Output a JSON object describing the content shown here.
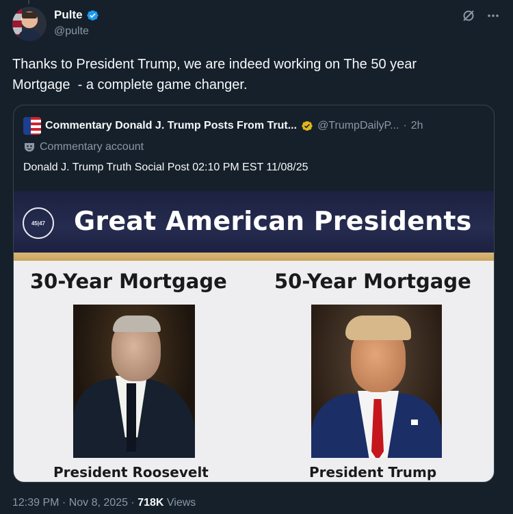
{
  "author": {
    "name": "Pulte",
    "handle": "@pulte"
  },
  "post": {
    "text": "Thanks to President Trump, we are indeed working on The 50 year\nMortgage  - a complete game changer."
  },
  "quote": {
    "name": "Commentary Donald J. Trump Posts From Trut...",
    "handle": "@TrumpDailyP...",
    "separator": "·",
    "time": "2h",
    "label": "Commentary account",
    "text": "Donald J. Trump Truth Social Post 02:10 PM EST 11/08/25"
  },
  "image": {
    "seal_text": "45|47",
    "title": "Great American Presidents",
    "left_title": "30-Year Mortgage",
    "right_title": "50-Year Mortgage",
    "left_caption": "President Roosevelt",
    "right_caption": "President Trump"
  },
  "meta": {
    "time": "12:39 PM",
    "sep1": " · ",
    "date": "Nov 8, 2025",
    "sep2": " · ",
    "views_count": "718K",
    "views_label": " Views"
  },
  "colors": {
    "background": "#15202b",
    "verified_blue": "#1d9bf0",
    "gold_badge": "#e2b719",
    "muted": "#8b98a5"
  },
  "icons": [
    "verified-badge-icon",
    "grok-icon",
    "more-icon",
    "gold-verified-icon",
    "commentary-mask-icon"
  ]
}
